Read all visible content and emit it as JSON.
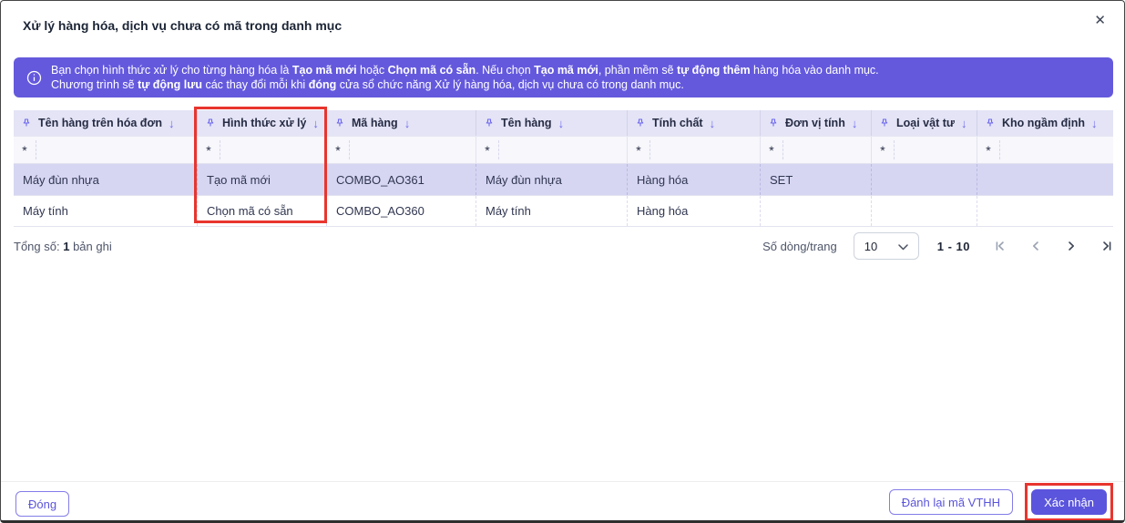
{
  "modal": {
    "title": "Xử lý hàng hóa, dịch vụ chưa có mã trong danh mục"
  },
  "icons": {
    "close": "✕",
    "sort_desc": "↓",
    "info": "info-circle",
    "pin": "pushpin"
  },
  "banner": {
    "line1": [
      {
        "text": "Bạn chọn hình thức xử lý cho từng hàng hóa là ",
        "bold": false
      },
      {
        "text": "Tạo mã mới",
        "bold": true
      },
      {
        "text": " hoặc ",
        "bold": false
      },
      {
        "text": "Chọn mã có sẵn",
        "bold": true
      },
      {
        "text": ". Nếu chọn ",
        "bold": false
      },
      {
        "text": "Tạo mã mới",
        "bold": true
      },
      {
        "text": ", phần mềm sẽ ",
        "bold": false
      },
      {
        "text": "tự động thêm",
        "bold": true
      },
      {
        "text": " hàng hóa vào danh mục.",
        "bold": false
      }
    ],
    "line2": [
      {
        "text": "Chương trình sẽ ",
        "bold": false
      },
      {
        "text": "tự động lưu",
        "bold": true
      },
      {
        "text": " các thay đổi mỗi khi ",
        "bold": false
      },
      {
        "text": "đóng",
        "bold": true
      },
      {
        "text": " cửa sổ chức năng Xử lý hàng hóa, dịch vụ chưa có trong danh mục.",
        "bold": false
      }
    ]
  },
  "table": {
    "filter_symbol": "*",
    "columns": [
      {
        "label": "Tên hàng trên hóa đơn"
      },
      {
        "label": "Hình thức xử lý"
      },
      {
        "label": "Mã hàng"
      },
      {
        "label": "Tên hàng"
      },
      {
        "label": "Tính chất"
      },
      {
        "label": "Đơn vị tính"
      },
      {
        "label": "Loại vật tư"
      },
      {
        "label": "Kho ngầm định"
      }
    ],
    "rows": [
      {
        "selected": true,
        "cells": [
          "Máy đùn nhựa",
          "Tạo mã mới",
          "COMBO_AO361",
          "Máy đùn nhựa",
          "Hàng hóa",
          "SET",
          "",
          ""
        ]
      },
      {
        "selected": false,
        "cells": [
          "Máy tính",
          "Chọn mã có sẵn",
          "COMBO_AO360",
          "Máy tính",
          "Hàng hóa",
          "",
          "",
          ""
        ]
      }
    ]
  },
  "pagination": {
    "total_label": "Tổng số:",
    "total_value": "1",
    "total_unit": "bản ghi",
    "rows_per_page_label": "Số dòng/trang",
    "rows_per_page_value": "10",
    "range": "1 - 10"
  },
  "footer": {
    "close_label": "Đóng",
    "reassign_label": "Đánh lại mã VTHH",
    "confirm_label": "Xác nhận"
  },
  "colors": {
    "accent": "#5b55dd",
    "banner_bg": "#6459dd",
    "header_bg": "#e4e4f6",
    "selected_row_bg": "#d6d6f3",
    "annotation_red": "#e8352e"
  }
}
